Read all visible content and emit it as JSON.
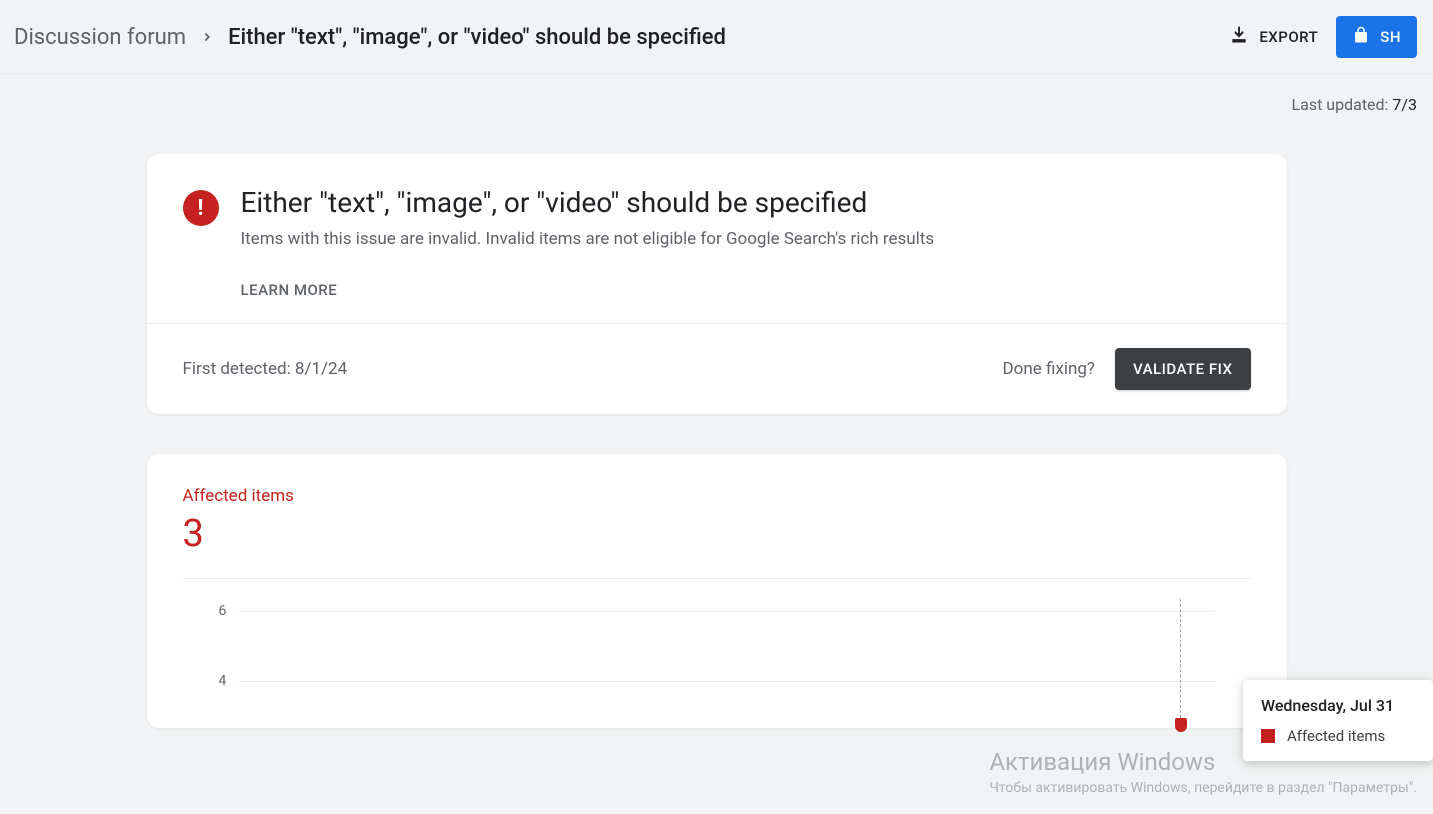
{
  "header": {
    "breadcrumb_root": "Discussion forum",
    "breadcrumb_current": "Either \"text\", \"image\", or \"video\" should be specified",
    "export_label": "EXPORT",
    "share_label": "SH"
  },
  "last_updated": {
    "label": "Last updated: ",
    "value": "7/3"
  },
  "issue": {
    "title": "Either \"text\", \"image\", or \"video\" should be specified",
    "description": "Items with this issue are invalid. Invalid items are not eligible for Google Search's rich results",
    "learn_more": "LEARN MORE",
    "first_detected_label": "First detected: ",
    "first_detected_value": "8/1/24",
    "done_fixing": "Done fixing?",
    "validate_fix": "VALIDATE FIX"
  },
  "affected": {
    "label": "Affected items",
    "count": "3"
  },
  "chart_data": {
    "type": "line",
    "title": "",
    "xlabel": "",
    "ylabel": "",
    "ylim": [
      0,
      6
    ],
    "yticks": [
      4,
      6
    ],
    "series": [
      {
        "name": "Affected items",
        "values": [
          3
        ]
      }
    ],
    "categories": [
      "Wednesday, Jul 31"
    ]
  },
  "tooltip": {
    "date": "Wednesday, Jul 31",
    "legend_label": "Affected items"
  },
  "watermark": {
    "title": "Активация Windows",
    "subtitle": "Чтобы активировать Windows, перейдите в раздел \"Параметры\"."
  },
  "yticks": {
    "t6": "6",
    "t4": "4"
  }
}
